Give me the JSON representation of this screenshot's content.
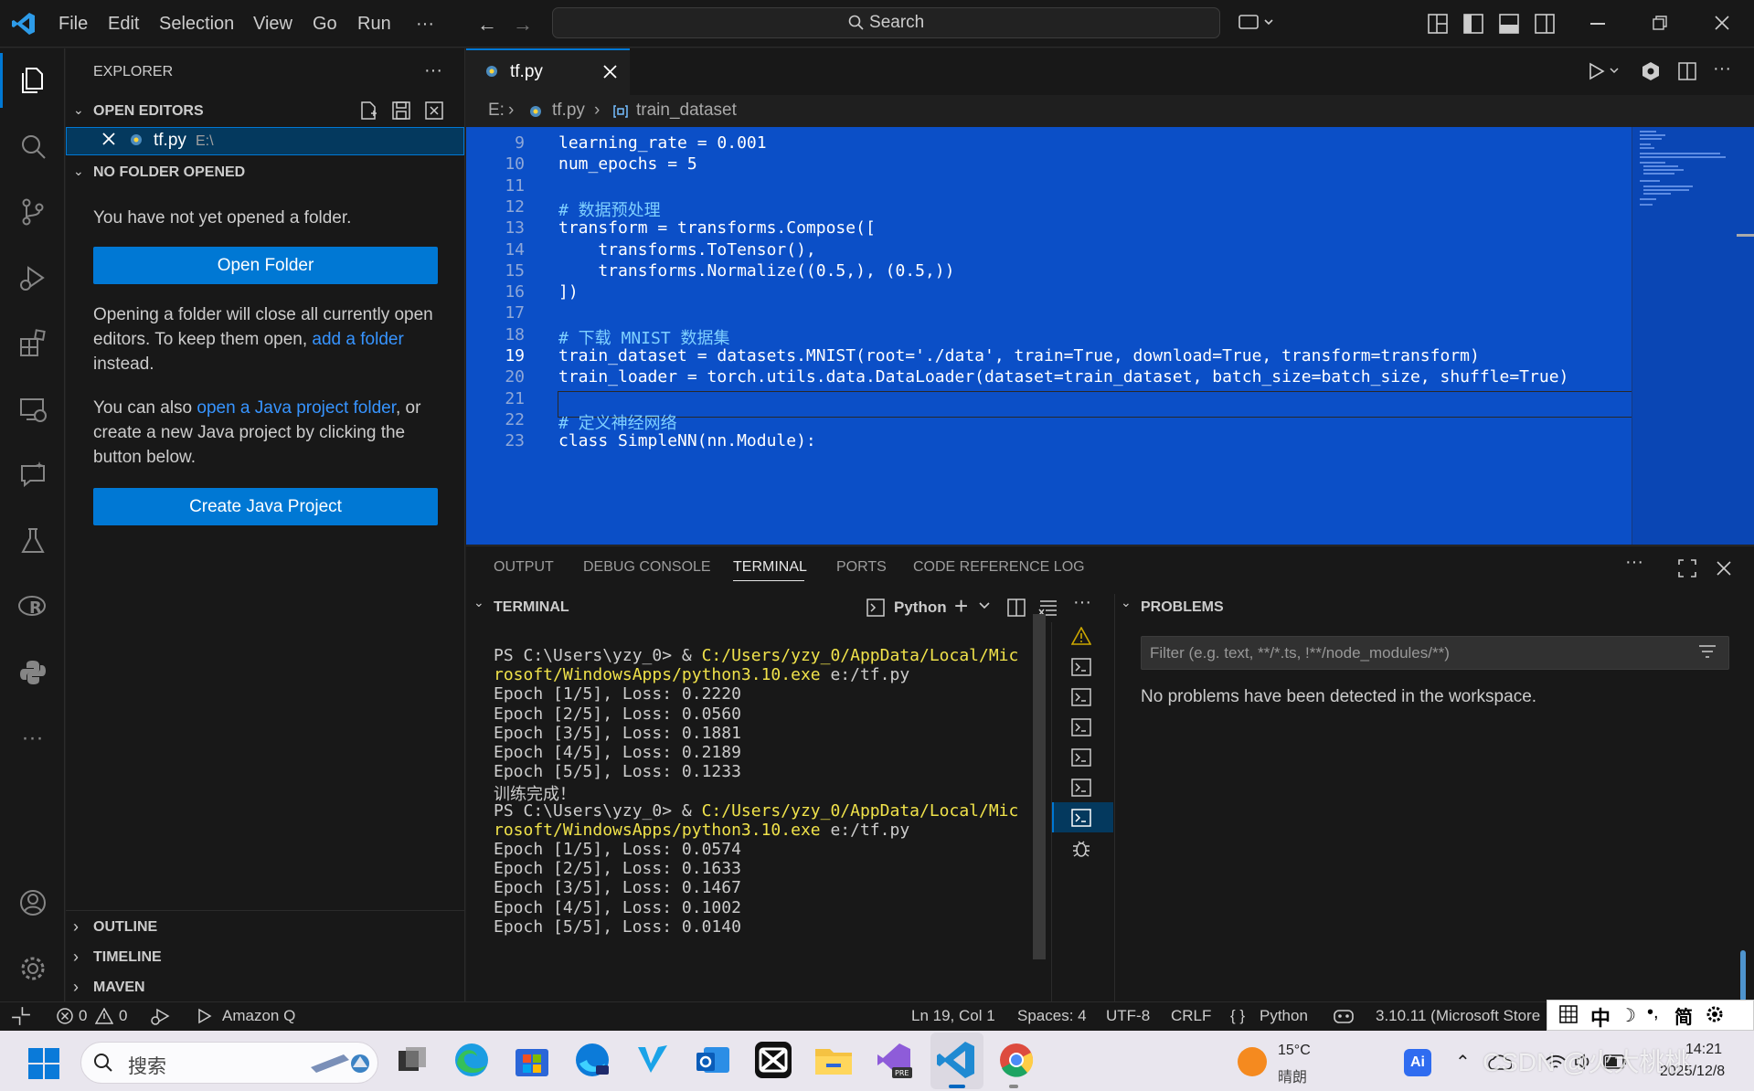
{
  "titlebar": {
    "menu": [
      "File",
      "Edit",
      "Selection",
      "View",
      "Go",
      "Run",
      "···"
    ],
    "search_label": "Search"
  },
  "activity_bar": {
    "icons": [
      "files-icon",
      "search-icon",
      "source-control-icon",
      "run-debug-icon",
      "extensions-icon",
      "remote-explorer-icon",
      "chat-icon",
      "testing-icon",
      "r-icon",
      "python-icon",
      "more-icon",
      "account-icon",
      "settings-icon"
    ]
  },
  "sidebar": {
    "title": "EXPLORER",
    "open_editors_label": "OPEN EDITORS",
    "open_editor": {
      "name": "tf.py",
      "path": "E:\\"
    },
    "no_folder_label": "NO FOLDER OPENED",
    "no_folder_msg": "You have not yet opened a folder.",
    "open_folder_btn": "Open Folder",
    "msg2_a": "Opening a folder will close all currently open editors. To keep them open, ",
    "msg2_link": "add a folder",
    "msg2_b": " instead.",
    "msg3_a": "You can also ",
    "msg3_link": "open a Java project folder",
    "msg3_b": ", or create a new Java project by clicking the button below.",
    "create_java_btn": "Create Java Project",
    "outline_label": "OUTLINE",
    "timeline_label": "TIMELINE",
    "maven_label": "MAVEN"
  },
  "editor": {
    "tab_name": "tf.py",
    "breadcrumb": [
      "E:",
      "tf.py",
      "train_dataset"
    ],
    "lines": [
      {
        "n": "9",
        "t": "learning_rate = 0.001"
      },
      {
        "n": "10",
        "t": "num_epochs = 5"
      },
      {
        "n": "11",
        "t": ""
      },
      {
        "n": "12",
        "t": "# 数据预处理"
      },
      {
        "n": "13",
        "t": "transform = transforms.Compose(["
      },
      {
        "n": "14",
        "t": "    transforms.ToTensor(),"
      },
      {
        "n": "15",
        "t": "    transforms.Normalize((0.5,), (0.5,))"
      },
      {
        "n": "16",
        "t": "])"
      },
      {
        "n": "17",
        "t": ""
      },
      {
        "n": "18",
        "t": "# 下载 MNIST 数据集"
      },
      {
        "n": "19",
        "t": "train_dataset = datasets.MNIST(root='./data', train=True, download=True, transform=transform)"
      },
      {
        "n": "20",
        "t": "train_loader = torch.utils.data.DataLoader(dataset=train_dataset, batch_size=batch_size, shuffle=True)"
      },
      {
        "n": "21",
        "t": ""
      },
      {
        "n": "22",
        "t": "# 定义神经网络"
      },
      {
        "n": "23",
        "t": "class SimpleNN(nn.Module):"
      }
    ]
  },
  "panel": {
    "tabs": [
      "OUTPUT",
      "DEBUG CONSOLE",
      "TERMINAL",
      "PORTS",
      "CODE REFERENCE LOG"
    ],
    "terminal_label": "TERMINAL",
    "terminal_profile": "Python",
    "problems_label": "PROBLEMS",
    "filter_placeholder": "Filter (e.g. text, **/*.ts, !**/node_modules/**)",
    "no_problems": "No problems have been detected in the workspace.",
    "terminal_lines": [
      {
        "p": "PS C:\\Users\\yzy_0> & ",
        "y": "C:/Users/yzy_0/AppData/Local/Mic"
      },
      {
        "p": "",
        "y": "rosoft/WindowsApps/python3.10.exe",
        "s": " e:/tf.py"
      },
      {
        "p": "Epoch [1/5], Loss: 0.2220"
      },
      {
        "p": "Epoch [2/5], Loss: 0.0560"
      },
      {
        "p": "Epoch [3/5], Loss: 0.1881"
      },
      {
        "p": "Epoch [4/5], Loss: 0.2189"
      },
      {
        "p": "Epoch [5/5], Loss: 0.1233"
      },
      {
        "p": "训练完成！"
      },
      {
        "p": "PS C:\\Users\\yzy_0> & ",
        "y": "C:/Users/yzy_0/AppData/Local/Mic"
      },
      {
        "p": "",
        "y": "rosoft/WindowsApps/python3.10.exe",
        "s": " e:/tf.py"
      },
      {
        "p": "Epoch [1/5], Loss: 0.0574"
      },
      {
        "p": "Epoch [2/5], Loss: 0.1633"
      },
      {
        "p": "Epoch [3/5], Loss: 0.1467"
      },
      {
        "p": "Epoch [4/5], Loss: 0.1002"
      },
      {
        "p": "Epoch [5/5], Loss: 0.0140"
      }
    ]
  },
  "statusbar": {
    "errors": "0",
    "warnings": "0",
    "amazon_q": "Amazon Q",
    "position": "Ln 19, Col 1",
    "spaces": "Spaces: 4",
    "encoding": "UTF-8",
    "eol": "CRLF",
    "language": "Python",
    "interpreter": "3.10.11 (Microsoft Store",
    "ime": "中"
  },
  "taskbar": {
    "search_placeholder": "搜索",
    "weather_temp": "15°C",
    "weather_desc": "晴朗",
    "time": "14:21",
    "date": "2025/12/8",
    "watermark": "CSDN @火大桃桃"
  }
}
